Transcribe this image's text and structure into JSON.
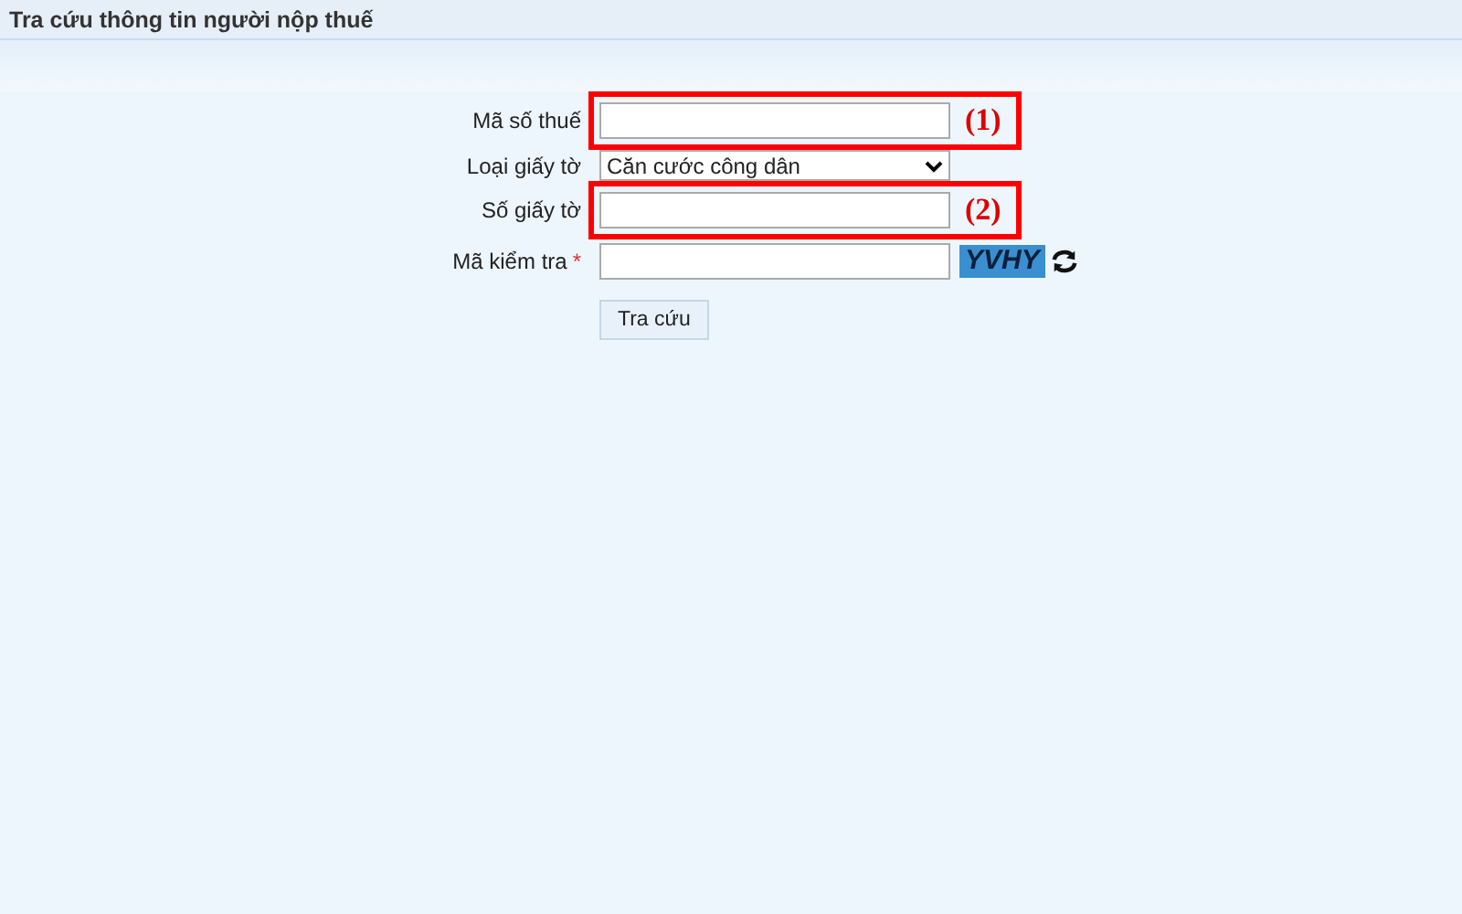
{
  "page_title": "Tra cứu thông tin người nộp thuế",
  "fields": [
    {
      "kind": "text",
      "label": "Mã số thuế",
      "annotation": "(1)"
    },
    {
      "kind": "select",
      "label": "Loại giấy tờ",
      "value": "Căn cước công dân"
    },
    {
      "kind": "text",
      "label": "Số giấy tờ",
      "annotation": "(2)"
    },
    {
      "kind": "captcha",
      "label": "Mã kiểm tra",
      "required_mark": "*",
      "captcha": "YVHY"
    }
  ],
  "button": "Tra cứu"
}
